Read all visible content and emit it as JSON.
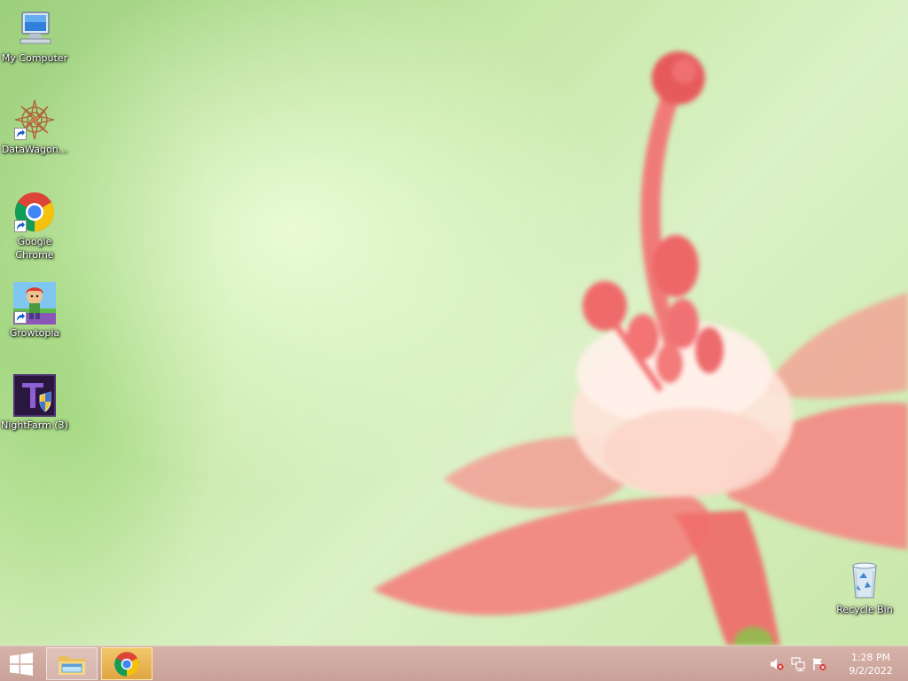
{
  "desktop": {
    "icons": [
      {
        "label": "My Computer",
        "icon": "computer-icon"
      },
      {
        "label": "DataWagon...",
        "icon": "datawagon-icon"
      },
      {
        "label": "Google Chrome",
        "icon": "chrome-icon"
      },
      {
        "label": "Growtopia",
        "icon": "growtopia-icon"
      },
      {
        "label": "NightFarm (3)",
        "icon": "nightfarm-icon"
      }
    ],
    "recycle_bin": {
      "label": "Recycle Bin",
      "icon": "recycle-bin-icon"
    }
  },
  "taskbar": {
    "start": {
      "icon": "windows-logo-icon"
    },
    "pinned": [
      {
        "name": "File Explorer",
        "icon": "file-explorer-icon"
      },
      {
        "name": "Google Chrome",
        "icon": "chrome-icon",
        "active": true
      }
    ],
    "tray": [
      {
        "icon": "speaker-muted-icon"
      },
      {
        "icon": "network-icon"
      },
      {
        "icon": "action-center-flag-icon"
      }
    ],
    "clock": {
      "time": "1:28 PM",
      "date": "9/2/2022"
    }
  },
  "colors": {
    "taskbar": "#c9a198",
    "active_task": "#e0a544",
    "wallpaper_green": "#c6e8a8",
    "flower_pink": "#f07a78"
  }
}
